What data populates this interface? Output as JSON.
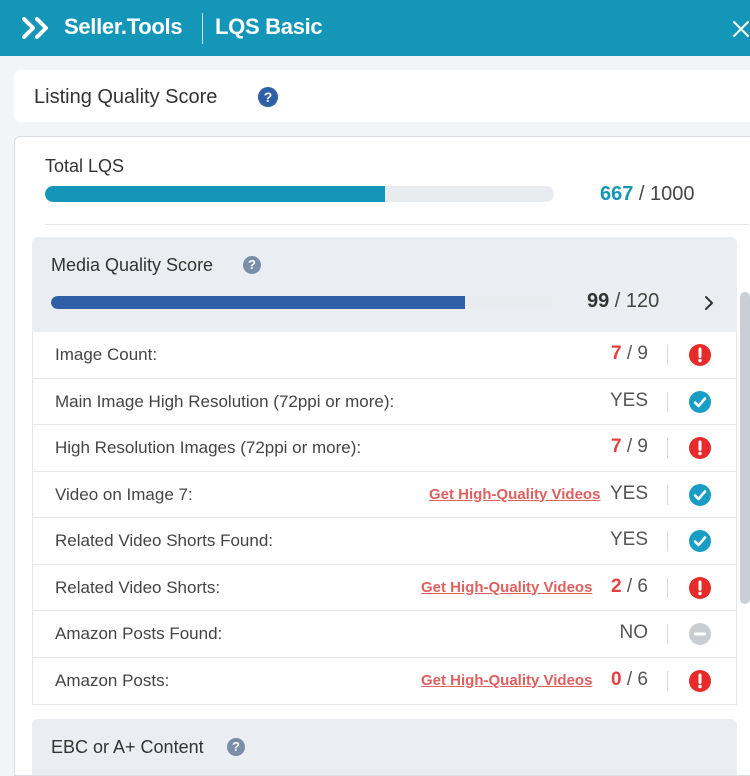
{
  "header": {
    "brand": "Seller.Tools",
    "product": "LQS Basic",
    "bg_color": "#1496b8"
  },
  "section_title": "Listing Quality Score",
  "total": {
    "label": "Total LQS",
    "score": "667",
    "max": "1000",
    "fraction": 0.667
  },
  "media": {
    "title": "Media Quality Score",
    "score": "99",
    "max": "120",
    "fraction": 0.825,
    "rows": [
      {
        "label": "Image Count:",
        "link": "",
        "value": "7",
        "max": "9",
        "status": "warning"
      },
      {
        "label": "Main Image High Resolution (72ppi or more):",
        "link": "",
        "value": "YES",
        "max": "",
        "status": "ok"
      },
      {
        "label": "High Resolution Images (72ppi or more):",
        "link": "",
        "value": "7",
        "max": "9",
        "status": "warning"
      },
      {
        "label": "Video on Image 7:",
        "link": "Get High-Quality Videos",
        "value": "YES",
        "max": "",
        "status": "ok"
      },
      {
        "label": "Related Video Shorts Found:",
        "link": "",
        "value": "YES",
        "max": "",
        "status": "ok"
      },
      {
        "label": "Related Video Shorts:",
        "link": "Get High-Quality Videos",
        "value": "2",
        "max": "6",
        "status": "warning"
      },
      {
        "label": "Amazon Posts Found:",
        "link": "",
        "value": "NO",
        "max": "",
        "status": "neutral"
      },
      {
        "label": "Amazon Posts:",
        "link": "Get High-Quality Videos",
        "value": "0",
        "max": "6",
        "status": "warning"
      }
    ]
  },
  "ebc": {
    "title": "EBC or A+ Content"
  },
  "help_glyph": "?",
  "score_separator": " / ",
  "colors": {
    "accent": "#1496b8",
    "media_bar": "#2f5fa6",
    "warning": "#e82a2a",
    "ok": "#1a9dc4",
    "neutral": "#c8cdd2",
    "link": "#e06060"
  }
}
